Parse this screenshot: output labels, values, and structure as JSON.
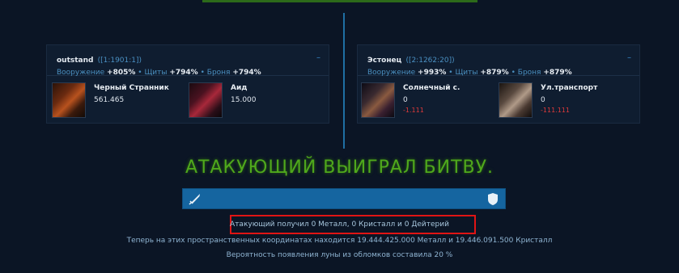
{
  "attacker": {
    "name": "outstand",
    "coords": "([1:1901:1])",
    "weapons_label": "Вооружение",
    "weapons_value": "+805%",
    "shields_label": "Щиты",
    "shields_value": "+794%",
    "armor_label": "Броня",
    "armor_value": "+794%",
    "collapse_icon": "minus-icon",
    "ships": [
      {
        "name": "Черный Странник",
        "count": "561.465",
        "loss": ""
      },
      {
        "name": "Аид",
        "count": "15.000",
        "loss": ""
      }
    ]
  },
  "defender": {
    "name": "Эстонец",
    "coords": "([2:1262:20])",
    "weapons_label": "Вооружение",
    "weapons_value": "+993%",
    "shields_label": "Щиты",
    "shields_value": "+879%",
    "armor_label": "Броня",
    "armor_value": "+879%",
    "collapse_icon": "minus-icon",
    "ships": [
      {
        "name": "Солнечный с.",
        "count": "0",
        "loss": "-1.111"
      },
      {
        "name": "Ул.транспорт",
        "count": "0",
        "loss": "-111.111"
      }
    ]
  },
  "result_title": "АТАКУЮЩИЙ ВЫИГРАЛ БИТВУ.",
  "loot_text": "Атакующий получил 0 Металл, 0 Кристалл и 0 Дейтерий",
  "debris_text": "Теперь на этих пространственных координатах находится 19.444.425.000 Металл и 19.446.091.500 Кристалл",
  "moon_text": "Вероятность появления луны из обломков составила 20 %",
  "colors": {
    "win": "#4fa81c",
    "loss": "#e03a3a",
    "bar": "#1565a0",
    "highlight": "#e01414"
  }
}
